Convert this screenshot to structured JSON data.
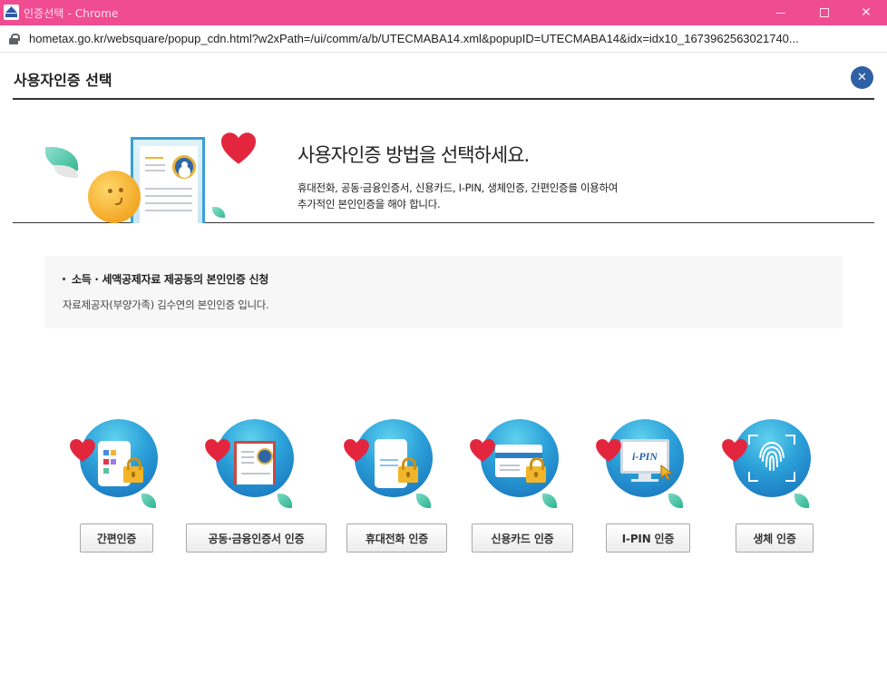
{
  "window": {
    "title": "인증선택 - Chrome",
    "controls": {
      "minimize": "—",
      "maximize": "☐",
      "close": "✕"
    }
  },
  "address_bar": {
    "url": "hometax.go.kr/websquare/popup_cdn.html?w2xPath=/ui/comm/a/b/UTECMABA14.xml&popupID=UTECMABA14&idx=idx10_1673962563021740..."
  },
  "popup": {
    "title": "사용자인증 선택",
    "close_label": "✕"
  },
  "banner": {
    "heading": "사용자인증 방법을 선택하세요.",
    "desc_line1": "휴대전화, 공동·금융인증서, 신용카드, I-PIN, 생체인증, 간편인증를 이용하여",
    "desc_line2": "추가적인 본인인증을 해야 합니다."
  },
  "info": {
    "title": "소득 · 세액공제자료 제공동의 본인인증 신청",
    "text": "자료제공자(부양가족) 김수연의 본인인증 입니다."
  },
  "methods": [
    {
      "label": "간편인증",
      "icon": "simple-auth-phone-icon"
    },
    {
      "label": "공동·금융인증서 인증",
      "icon": "certificate-icon"
    },
    {
      "label": "휴대전화 인증",
      "icon": "mobile-phone-icon"
    },
    {
      "label": "신용카드 인증",
      "icon": "credit-card-icon"
    },
    {
      "label": "I-PIN 인증",
      "icon": "ipin-monitor-icon",
      "icon_text": "i-PIN"
    },
    {
      "label": "생체 인증",
      "icon": "fingerprint-icon"
    }
  ],
  "colors": {
    "titlebar": "#ef4c91",
    "close_button": "#2f5fa5",
    "icon_circle": "#2a9fd8",
    "heart": "#e3263e",
    "padlock": "#f2b529"
  }
}
